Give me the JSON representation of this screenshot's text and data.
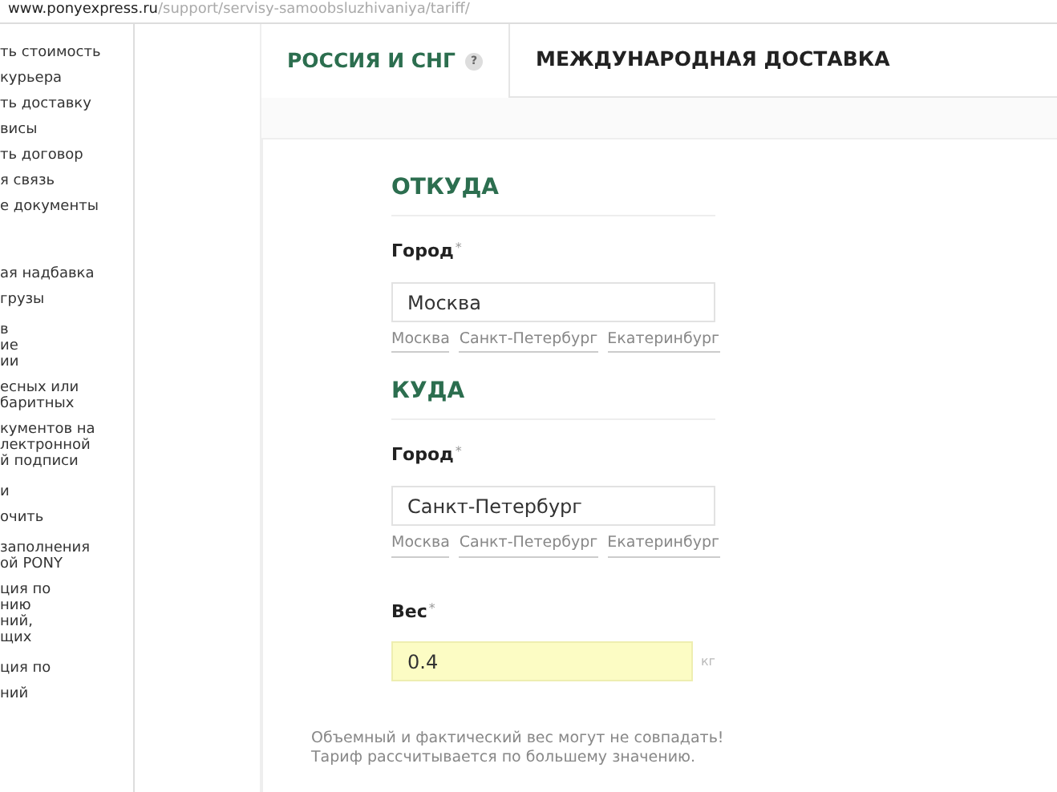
{
  "address_bar": {
    "host": "www.ponyexpress.ru",
    "path": "/support/servisy-samoobsluzhivaniya/tariff/"
  },
  "sidebar": {
    "items": [
      {
        "lines": [
          "ть стоимость"
        ]
      },
      {
        "lines": [
          "курьера"
        ]
      },
      {
        "lines": [
          "ть доставку"
        ]
      },
      {
        "lines": [
          "висы"
        ]
      },
      {
        "lines": [
          "ть договор"
        ]
      },
      {
        "lines": [
          "я связь"
        ]
      },
      {
        "lines": [
          "е документы"
        ]
      },
      {
        "lines": [
          "ая надбавка"
        ]
      },
      {
        "lines": [
          "грузы"
        ]
      },
      {
        "lines": [
          "в",
          "ие",
          "ии"
        ]
      },
      {
        "lines": [
          "есных или",
          "баритных"
        ]
      },
      {
        "lines": [
          "кументов на",
          "лектронной",
          "й подписи"
        ]
      },
      {
        "lines": [
          "и"
        ]
      },
      {
        "lines": [
          "очить"
        ]
      },
      {
        "lines": [
          "заполнения",
          "ой PONY"
        ]
      },
      {
        "lines": [
          "ция по",
          "нию",
          "ний,",
          "щих"
        ]
      },
      {
        "lines": [
          "ция по"
        ]
      },
      {
        "lines": [
          "ний"
        ]
      }
    ]
  },
  "tabs": [
    {
      "label": "РОССИЯ И СНГ",
      "help": "?",
      "selected": true
    },
    {
      "label": "МЕЖДУНАРОДНАЯ ДОСТАВКА",
      "selected": false
    }
  ],
  "sections": [
    {
      "kind": "city",
      "heading": "ОТКУДА",
      "label": "Город",
      "required": "*",
      "value": "Москва",
      "suggestions": [
        "Москва",
        "Санкт-Петербург",
        "Екатеринбург"
      ]
    },
    {
      "kind": "city",
      "heading": "КУДА",
      "label": "Город",
      "required": "*",
      "value": "Санкт-Петербург",
      "suggestions": [
        "Москва",
        "Санкт-Петербург",
        "Екатеринбург"
      ]
    },
    {
      "kind": "weight",
      "label": "Вес",
      "required": "*",
      "value": "0.4",
      "unit": "кг",
      "highlighted": true
    }
  ],
  "note": [
    "Объемный и фактический вес могут не совпадать!",
    "Тариф рассчитывается по большему значению."
  ]
}
